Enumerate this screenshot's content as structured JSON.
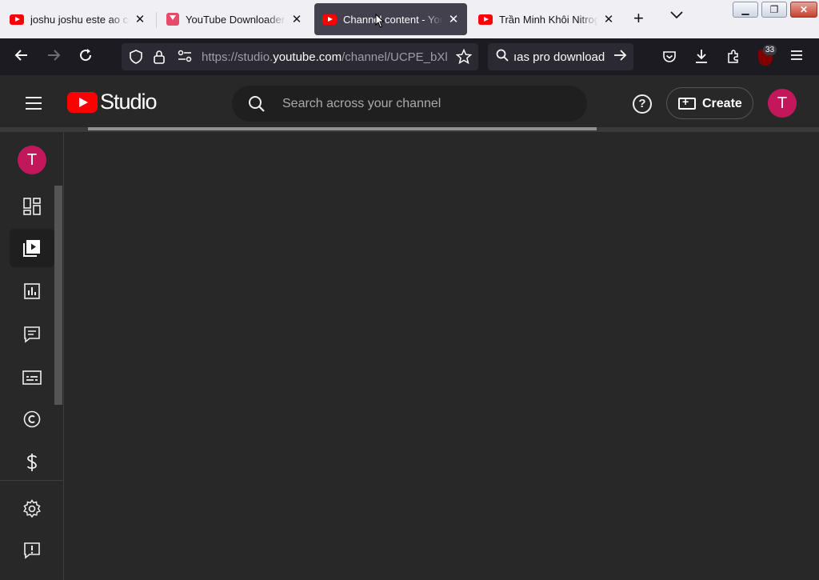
{
  "browser": {
    "tabs": [
      {
        "title": "joshu joshu este ao co",
        "favicon": "youtube-icon",
        "active": false
      },
      {
        "title": "YouTube Downloader",
        "favicon": "download-icon",
        "active": false
      },
      {
        "title": "Channel content - You",
        "favicon": "youtube-icon",
        "active": true
      },
      {
        "title": "Trần Minh Khôi Nitrog",
        "favicon": "youtube-icon",
        "active": false
      }
    ],
    "new_tab_symbol": "+",
    "tab_list_symbol": "⌵",
    "url_prefix": "https://studio.",
    "url_domain": "youtube.com",
    "url_path": "/channel/UCPE_bXl",
    "search_text": "ıas pro download",
    "extensions_badge": "33"
  },
  "studio": {
    "logo_text": "Studio",
    "search_placeholder": "Search across your channel",
    "help_symbol": "?",
    "create_label": "Create",
    "avatar_letter": "T"
  },
  "sidebar": {
    "avatar_letter": "T",
    "items": [
      {
        "name": "dashboard",
        "icon": "dashboard-icon",
        "active": false
      },
      {
        "name": "content",
        "icon": "content-icon",
        "active": true
      },
      {
        "name": "analytics",
        "icon": "analytics-icon",
        "active": false
      },
      {
        "name": "comments",
        "icon": "comments-icon",
        "active": false
      },
      {
        "name": "subtitles",
        "icon": "subtitles-icon",
        "active": false
      },
      {
        "name": "copyright",
        "icon": "copyright-icon",
        "active": false
      },
      {
        "name": "earn",
        "icon": "dollar-icon",
        "active": false
      },
      {
        "name": "settings",
        "icon": "gear-icon",
        "active": false
      },
      {
        "name": "send-feedback",
        "icon": "feedback-icon",
        "active": false
      }
    ]
  },
  "colors": {
    "brand_red": "#ff0000",
    "avatar_bg": "#c2185b",
    "studio_bg": "#282828"
  }
}
